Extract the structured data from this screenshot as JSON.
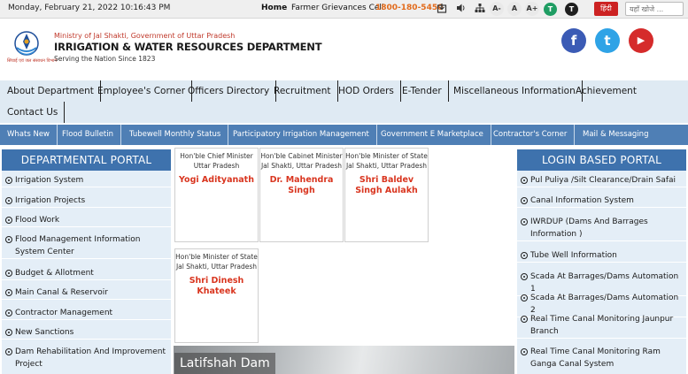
{
  "topbar": {
    "datetime": "Monday, February 21, 2022 10:16:43 PM",
    "home": "Home",
    "grievance_label": "Farmer Grievances Cell",
    "phone": "1800-180-5450",
    "font_small": "A-",
    "font_normal": "A",
    "font_large": "A+",
    "theme_light": "T",
    "theme_dark": "T",
    "hindi": "हिंदी",
    "search_placeholder": "यहाँ खोजे ..."
  },
  "header": {
    "logo_caption": "सिंचाई एवं जल संसाधन विभाग",
    "ministry": "Ministry of Jal Shakti, Government of Uttar Pradesh",
    "department": "IRRIGATION & WATER RESOURCES DEPARTMENT",
    "tagline": "Serving the Nation Since 1823",
    "social": {
      "facebook": "f",
      "twitter": "t",
      "youtube": "▶"
    },
    "colors": {
      "facebook": "#3b5bb5",
      "twitter": "#2fa3e6",
      "youtube": "#d52b2b"
    }
  },
  "main_nav": [
    "About Department",
    "Employee's Corner",
    "Officers Directory",
    "Recruitment",
    "HOD Orders",
    "E-Tender",
    "Miscellaneous Information",
    "Achievement",
    "Contact Us"
  ],
  "sub_nav": [
    "Whats New",
    "Flood Bulletin",
    "Tubewell Monthly Status",
    "Participatory Irrigation Management",
    "Government E Marketplace",
    "Contractor's Corner",
    "Mail & Messaging"
  ],
  "departmental_portal": {
    "title": "DEPARTMENTAL PORTAL",
    "items": [
      "Irrigation System",
      "Irrigation Projects",
      "Flood Work",
      "Flood Management Information System Center",
      "Budget & Allotment",
      "Main Canal & Reservoir",
      "Contractor Management",
      "New Sanctions",
      "Dam Rehabilitation And Improvement Project"
    ]
  },
  "login_portal": {
    "title": "LOGIN BASED PORTAL",
    "items": [
      "Pul Puliya /Silt Clearance/Drain Safai",
      "Canal Information System",
      "IWRDUP (Dams And Barrages Information )",
      "Tube Well Information",
      "Scada At Barrages/Dams Automation 1",
      "Scada At Barrages/Dams Automation 2",
      "Real Time Canal Monitoring Jaunpur Branch",
      "Real Time Canal Monitoring Ram Ganga Canal System"
    ]
  },
  "dignitaries": [
    {
      "role1": "Hon'ble Chief Minister",
      "role2": "Uttar Pradesh",
      "name": "Yogi Adityanath"
    },
    {
      "role1": "Hon'ble Cabinet Minister",
      "role2": "Jal Shakti, Uttar Pradesh",
      "name": "Dr. Mahendra Singh"
    },
    {
      "role1": "Hon'ble Minister of State",
      "role2": "Jal Shakti, Uttar Pradesh",
      "name": "Shri Baldev Singh Aulakh"
    },
    {
      "role1": "Hon'ble Minister of State",
      "role2": "Jal Shakti, Uttar Pradesh",
      "name": "Shri Dinesh Khateek"
    }
  ],
  "slider": {
    "caption": "Latifshah Dam"
  }
}
